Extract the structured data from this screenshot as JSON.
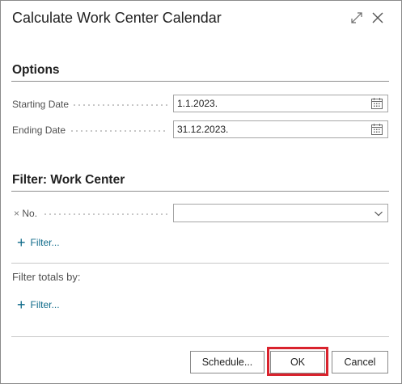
{
  "dialog": {
    "title": "Calculate Work Center Calendar",
    "expand_icon": "expand-icon",
    "close_icon": "close-icon"
  },
  "options": {
    "section_title": "Options",
    "starting_date_label": "Starting Date",
    "starting_date_value": "1.1.2023.",
    "ending_date_label": "Ending Date",
    "ending_date_value": "31.12.2023.",
    "calendar_icon": "calendar-icon"
  },
  "filter_work_center": {
    "section_title": "Filter: Work Center",
    "remove_icon": "×",
    "no_label": "No.",
    "no_value": "",
    "add_filter_label": "Filter..."
  },
  "filter_totals": {
    "label": "Filter totals by:",
    "add_filter_label": "Filter..."
  },
  "footer": {
    "schedule_label": "Schedule...",
    "ok_label": "OK",
    "cancel_label": "Cancel"
  },
  "colors": {
    "link": "#0f6b8a",
    "highlight": "#d9232d"
  }
}
